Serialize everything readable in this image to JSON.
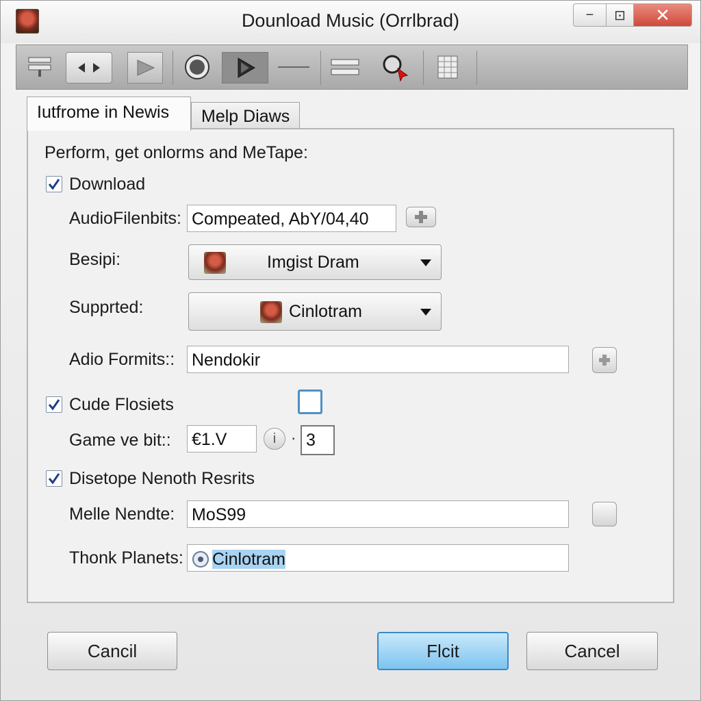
{
  "window": {
    "title": "Dounload Music (Orrlbrad)",
    "controls": {
      "minimize": "−",
      "maximize": "⊡",
      "close": "✕"
    }
  },
  "toolbar": {
    "icons": [
      "list-icon",
      "arrows-icon",
      "play-icon",
      "record-icon",
      "play-active-icon",
      "line-icon",
      "bars-icon",
      "zoom-icon",
      "grid-icon"
    ]
  },
  "tabs": [
    {
      "label": "Iutfrome in Newis",
      "active": true
    },
    {
      "label": "Melp Diaws",
      "active": false
    }
  ],
  "panel": {
    "heading": "Perform, get onlorms and MeTape:",
    "download": {
      "label": "Download",
      "checked": true
    },
    "audio_filenbits": {
      "label": "AudioFilenbits:",
      "value": "Compeated, AbY/04,40"
    },
    "besipi": {
      "label": "Besipi:",
      "value": "Imgist Dram"
    },
    "supported": {
      "label": "Supprted:",
      "value": "Cinlotram"
    },
    "adio_formits": {
      "label": "Adio Formits::",
      "value": "Nendokir"
    },
    "cude_flosiets": {
      "label": "Cude Flosiets",
      "checked": true
    },
    "game_ve_bit": {
      "label": "Game ve bit::",
      "value": "€1.V",
      "info": "i",
      "separator": "·",
      "count": "3"
    },
    "disetope": {
      "label": "Disetope Nenoth Resrits",
      "checked": true
    },
    "melle_nendte": {
      "label": "Melle Nendte:",
      "value": "MoS99"
    },
    "thonk_planets": {
      "label": "Thonk Planets:",
      "value": "Cinlotram"
    }
  },
  "buttons": {
    "cancel_left": "Cancil",
    "primary": "Flcit",
    "cancel_right": "Cancel"
  },
  "colors": {
    "primary_button": "#7ec3ee",
    "close_button": "#cf4a3b",
    "check_mark": "#1d3f8a",
    "selection": "#a9d3f2"
  }
}
